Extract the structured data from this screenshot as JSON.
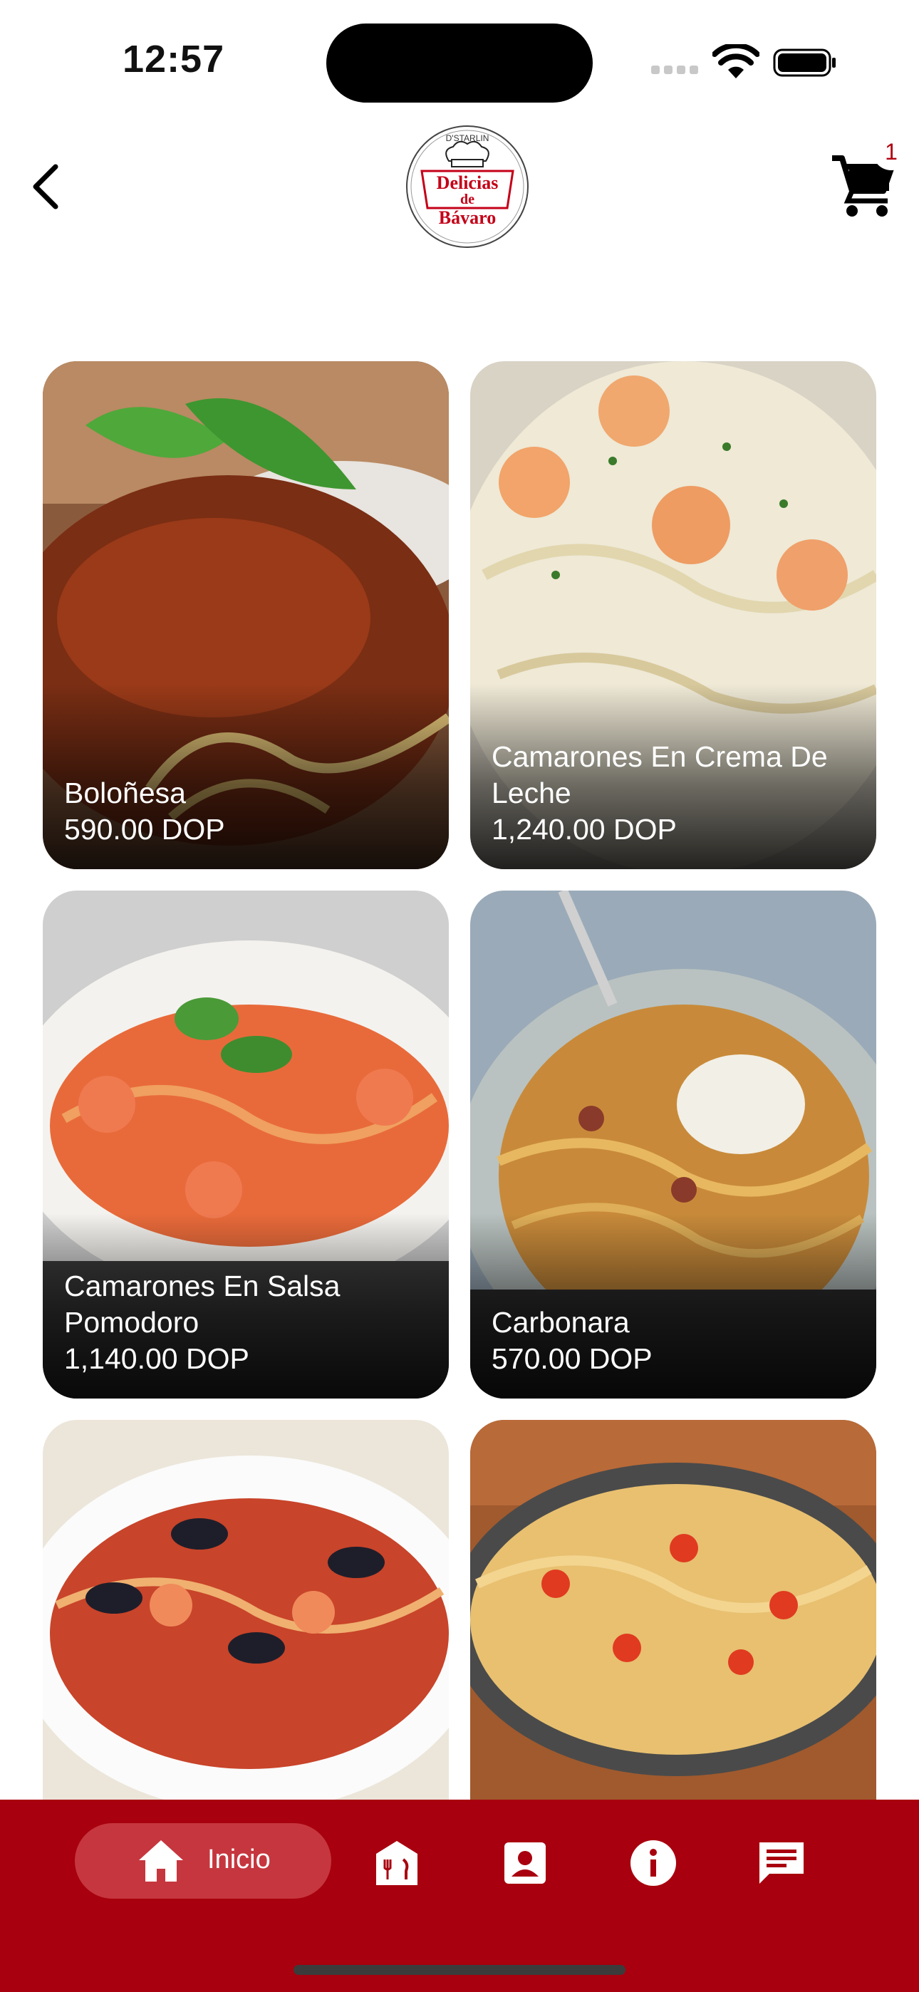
{
  "status_bar": {
    "time": "12:57"
  },
  "header": {
    "logo_text": {
      "top": "D'STARLIN",
      "line1": "Delicias",
      "line2": "de",
      "line3": "Bávaro"
    },
    "cart_count": "1"
  },
  "products": [
    {
      "name": "Boloñesa",
      "price": "590.00 DOP"
    },
    {
      "name": "Camarones En Crema De Leche",
      "price": "1,240.00 DOP"
    },
    {
      "name": "Camarones En Salsa Pomodoro",
      "price": "1,140.00 DOP"
    },
    {
      "name": "Carbonara",
      "price": "570.00 DOP"
    },
    {
      "name": "",
      "price": ""
    },
    {
      "name": "",
      "price": ""
    }
  ],
  "bottom_nav": {
    "home_label": "Inicio",
    "items": [
      "home-icon",
      "restaurant-menu-icon",
      "contact-icon",
      "info-icon",
      "chat-icon"
    ]
  },
  "colors": {
    "brand_red": "#a8000e",
    "active_pill": "#c6363e"
  }
}
